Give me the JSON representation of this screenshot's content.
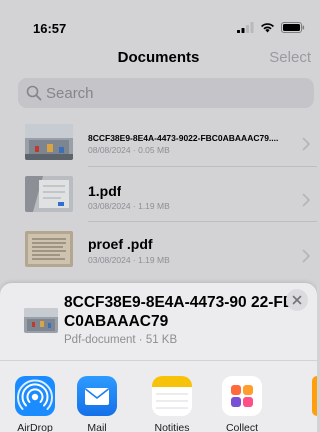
{
  "status_bar": {
    "time": "16:57"
  },
  "nav": {
    "title": "Documents",
    "select_label": "Select"
  },
  "search": {
    "placeholder": "Search"
  },
  "files": [
    {
      "name": "8CCF38E9-8E4A-4473-9022-FBC0ABAAAC79....",
      "meta": "08/08/2024 · 0.05 MB"
    },
    {
      "name": "1.pdf",
      "meta": "03/08/2024 · 1.19 MB"
    },
    {
      "name": "proef .pdf",
      "meta": "03/08/2024 · 1.19 MB"
    }
  ],
  "share_sheet": {
    "title": "8CCF38E9-8E4A-4473-90 22-FBC0ABAAAC79",
    "subtitle": "Pdf-document · 51 KB",
    "apps": [
      {
        "label": "AirDrop",
        "icon": "airdrop-icon"
      },
      {
        "label": "Mail",
        "icon": "mail-icon"
      },
      {
        "label": "Notities",
        "icon": "notes-icon"
      },
      {
        "label": "Collect",
        "icon": "collect-icon"
      }
    ]
  },
  "colors": {
    "background": "#d3d3d6",
    "accent_blue": "#1a8cff",
    "secondary_text": "#8e8e93",
    "notes_yellow": "#f7c20a"
  }
}
